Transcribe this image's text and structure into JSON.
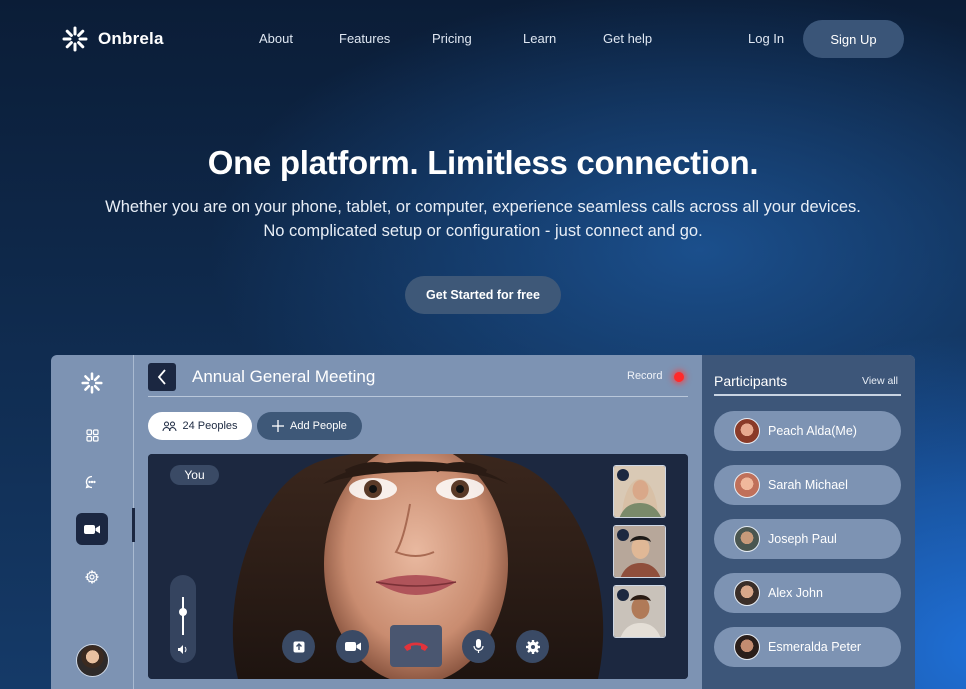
{
  "nav": {
    "brand": "Onbrela",
    "links": [
      "About",
      "Features",
      "Pricing",
      "Learn",
      "Get help"
    ],
    "login": "Log In",
    "signup": "Sign Up"
  },
  "hero": {
    "title": "One platform. Limitless connection.",
    "subtitle_line1": "Whether you are on your phone, tablet, or computer, experience seamless calls across all your devices.",
    "subtitle_line2": "No complicated setup or configuration - just connect and go.",
    "cta": "Get Started for free"
  },
  "app": {
    "sidebar_icons": [
      "sun-logo-icon",
      "grid-icon",
      "chat-icon",
      "video-icon",
      "settings-icon"
    ],
    "active_icon": "video-icon",
    "meeting_title": "Annual General Meeting",
    "record_label": "Record",
    "people_count_label": "24 Peoples",
    "add_people_label": "Add People",
    "self_tag": "You",
    "volume_level": 0.6,
    "controls": [
      "share-screen-icon",
      "camera-icon",
      "end-call-icon",
      "mic-icon",
      "settings-icon"
    ],
    "participants_title": "Participants",
    "view_all": "View all",
    "participants": [
      {
        "name": "Peach Alda(Me)"
      },
      {
        "name": "Sarah Michael"
      },
      {
        "name": "Joseph Paul"
      },
      {
        "name": "Alex John"
      },
      {
        "name": "Esmeralda Peter"
      }
    ]
  },
  "colors": {
    "accent_button": "#3a5578",
    "panel": "#7d93b3",
    "panel_dark": "#3d5679",
    "record_red": "#ff2a2a",
    "end_call_red": "#e2333b"
  }
}
